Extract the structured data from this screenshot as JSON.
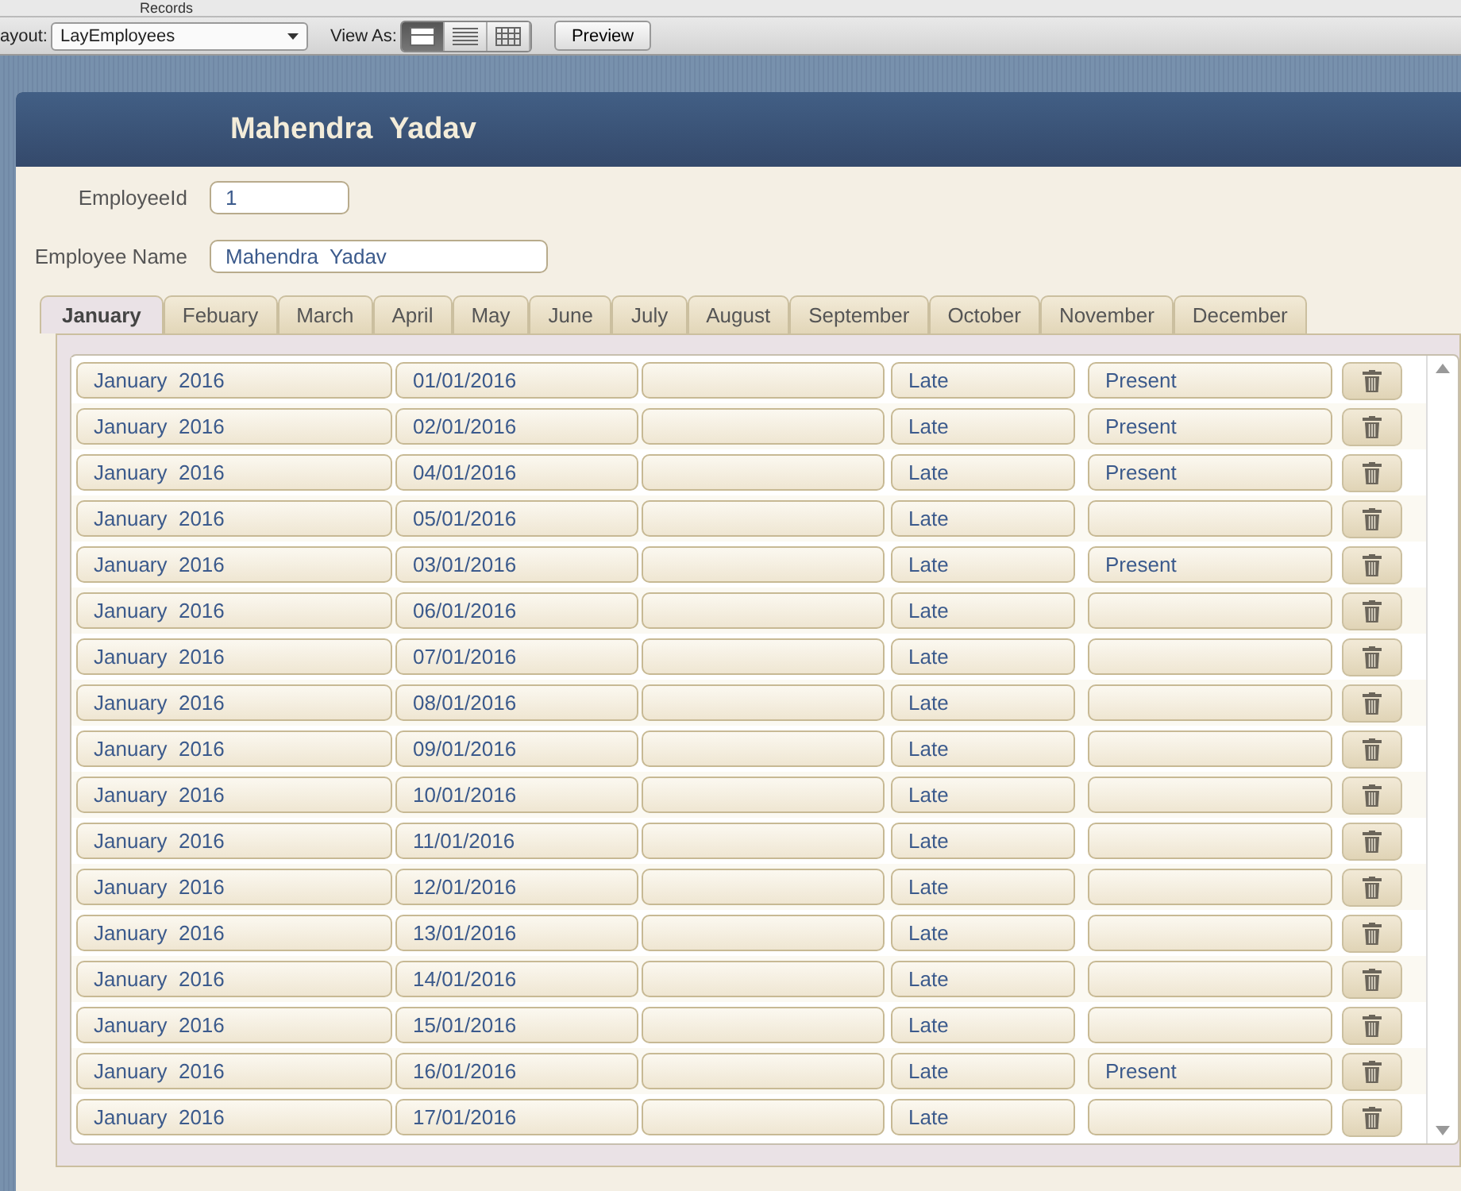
{
  "top_bar": {
    "label": "Records"
  },
  "toolbar": {
    "layout_label": "ayout:",
    "layout_value": "LayEmployees",
    "view_as_label": "View As:",
    "view_buttons": [
      {
        "kind": "form",
        "selected": true
      },
      {
        "kind": "list",
        "selected": false
      },
      {
        "kind": "table",
        "selected": false
      }
    ],
    "preview_button": "Preview"
  },
  "header": {
    "title": "Mahendra  Yadav"
  },
  "fields": [
    {
      "label": "EmployeeId",
      "value": "1",
      "kind": "short"
    },
    {
      "label": "Employee Name",
      "value": "Mahendra  Yadav",
      "kind": "long"
    }
  ],
  "tabs": [
    {
      "label": "January",
      "selected": true
    },
    {
      "label": "Febuary",
      "selected": false
    },
    {
      "label": "March",
      "selected": false
    },
    {
      "label": "April",
      "selected": false
    },
    {
      "label": "May",
      "selected": false
    },
    {
      "label": "June",
      "selected": false
    },
    {
      "label": "July",
      "selected": false
    },
    {
      "label": "August",
      "selected": false
    },
    {
      "label": "September",
      "selected": false
    },
    {
      "label": "October",
      "selected": false
    },
    {
      "label": "November",
      "selected": false
    },
    {
      "label": "December",
      "selected": false
    }
  ],
  "rows": [
    {
      "month": "January  2016",
      "date": "01/01/2016",
      "column_4": "Late",
      "column_5": "Present"
    },
    {
      "month": "January  2016",
      "date": "02/01/2016",
      "column_4": "Late",
      "column_5": "Present"
    },
    {
      "month": "January  2016",
      "date": "04/01/2016",
      "column_4": "Late",
      "column_5": "Present"
    },
    {
      "month": "January  2016",
      "date": "05/01/2016",
      "column_4": "Late"
    },
    {
      "month": "January  2016",
      "date": "03/01/2016",
      "column_4": "Late",
      "column_5": "Present"
    },
    {
      "month": "January  2016",
      "date": "06/01/2016",
      "column_4": "Late"
    },
    {
      "month": "January  2016",
      "date": "07/01/2016",
      "column_4": "Late"
    },
    {
      "month": "January  2016",
      "date": "08/01/2016",
      "column_4": "Late"
    },
    {
      "month": "January  2016",
      "date": "09/01/2016",
      "column_4": "Late"
    },
    {
      "month": "January  2016",
      "date": "10/01/2016",
      "column_4": "Late"
    },
    {
      "month": "January  2016",
      "date": "11/01/2016",
      "column_4": "Late"
    },
    {
      "month": "January  2016",
      "date": "12/01/2016",
      "column_4": "Late"
    },
    {
      "month": "January  2016",
      "date": "13/01/2016",
      "column_4": "Late"
    },
    {
      "month": "January  2016",
      "date": "14/01/2016",
      "column_4": "Late"
    },
    {
      "month": "January  2016",
      "date": "15/01/2016",
      "column_4": "Late"
    },
    {
      "month": "January  2016",
      "date": "16/01/2016",
      "column_4": "Late",
      "column_5": "Present"
    },
    {
      "month": "January  2016",
      "date": "17/01/2016",
      "column_4": "Late"
    }
  ]
}
